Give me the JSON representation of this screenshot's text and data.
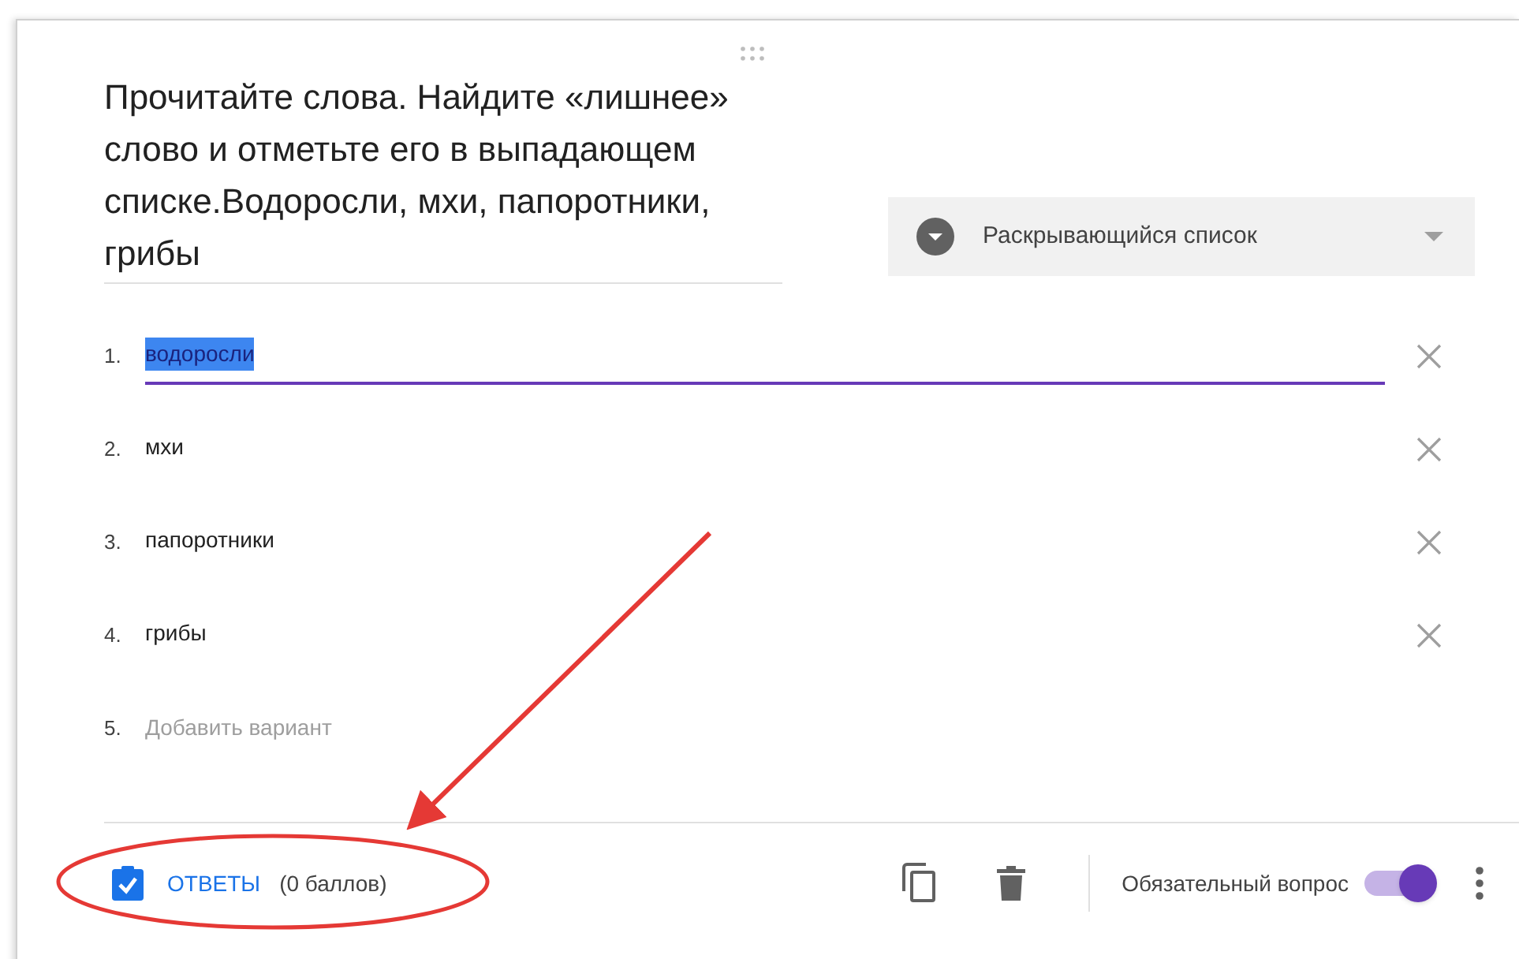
{
  "question": {
    "text": "Прочитайте слова. Найдите «лишнее» слово и отметьте его в выпадающем списке.Водоросли, мхи, папоротники, грибы"
  },
  "type_select": {
    "label": "Раскрывающийся список"
  },
  "options": [
    {
      "number": "1.",
      "text": "водоросли",
      "selected": true
    },
    {
      "number": "2.",
      "text": "мхи",
      "selected": false
    },
    {
      "number": "3.",
      "text": "папоротники",
      "selected": false
    },
    {
      "number": "4.",
      "text": "грибы",
      "selected": false
    }
  ],
  "add_option": {
    "number": "5.",
    "placeholder": "Добавить вариант"
  },
  "footer": {
    "answers_label": "ОТВЕТЫ",
    "points": "(0 баллов)",
    "required_label": "Обязательный вопрос",
    "required_on": true
  }
}
